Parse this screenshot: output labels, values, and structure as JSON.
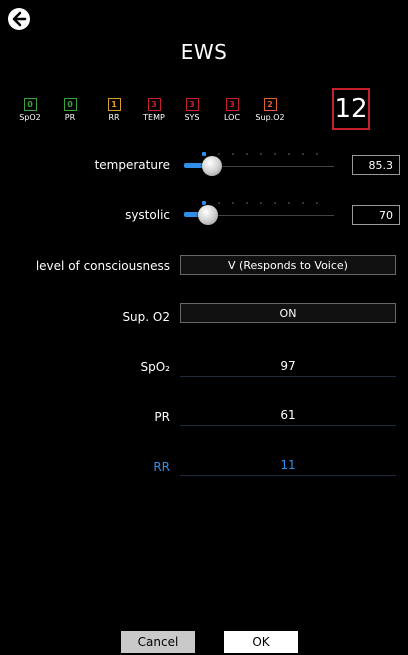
{
  "header": {
    "title": "EWS"
  },
  "scores": [
    {
      "value": "0",
      "label": "SpO2",
      "color": "#3aa23a"
    },
    {
      "value": "0",
      "label": "PR",
      "color": "#3aa23a"
    },
    {
      "value": "1",
      "label": "RR",
      "color": "#d8a028"
    },
    {
      "value": "3",
      "label": "TEMP",
      "color": "#c8202a"
    },
    {
      "value": "3",
      "label": "SYS",
      "color": "#c8202a"
    },
    {
      "value": "3",
      "label": "LOC",
      "color": "#c8202a"
    },
    {
      "value": "2",
      "label": "Sup.O2",
      "color": "#e06030"
    }
  ],
  "total_score": "12",
  "fields": {
    "temperature": {
      "label": "temperature",
      "value": "85.3"
    },
    "systolic": {
      "label": "systolic",
      "value": "70"
    },
    "loc": {
      "label": "level of consciousness",
      "value": "V (Responds to Voice)"
    },
    "supo2": {
      "label": "Sup. O2",
      "value": "ON"
    },
    "spo2": {
      "label": "SpO₂",
      "value": "97"
    },
    "pr": {
      "label": "PR",
      "value": "61"
    },
    "rr": {
      "label": "RR",
      "value": "11"
    }
  },
  "footer": {
    "cancel_label": "Cancel",
    "ok_label": "OK"
  },
  "colors": {
    "accent": "#2f8fe8",
    "alert": "#c8202a"
  }
}
